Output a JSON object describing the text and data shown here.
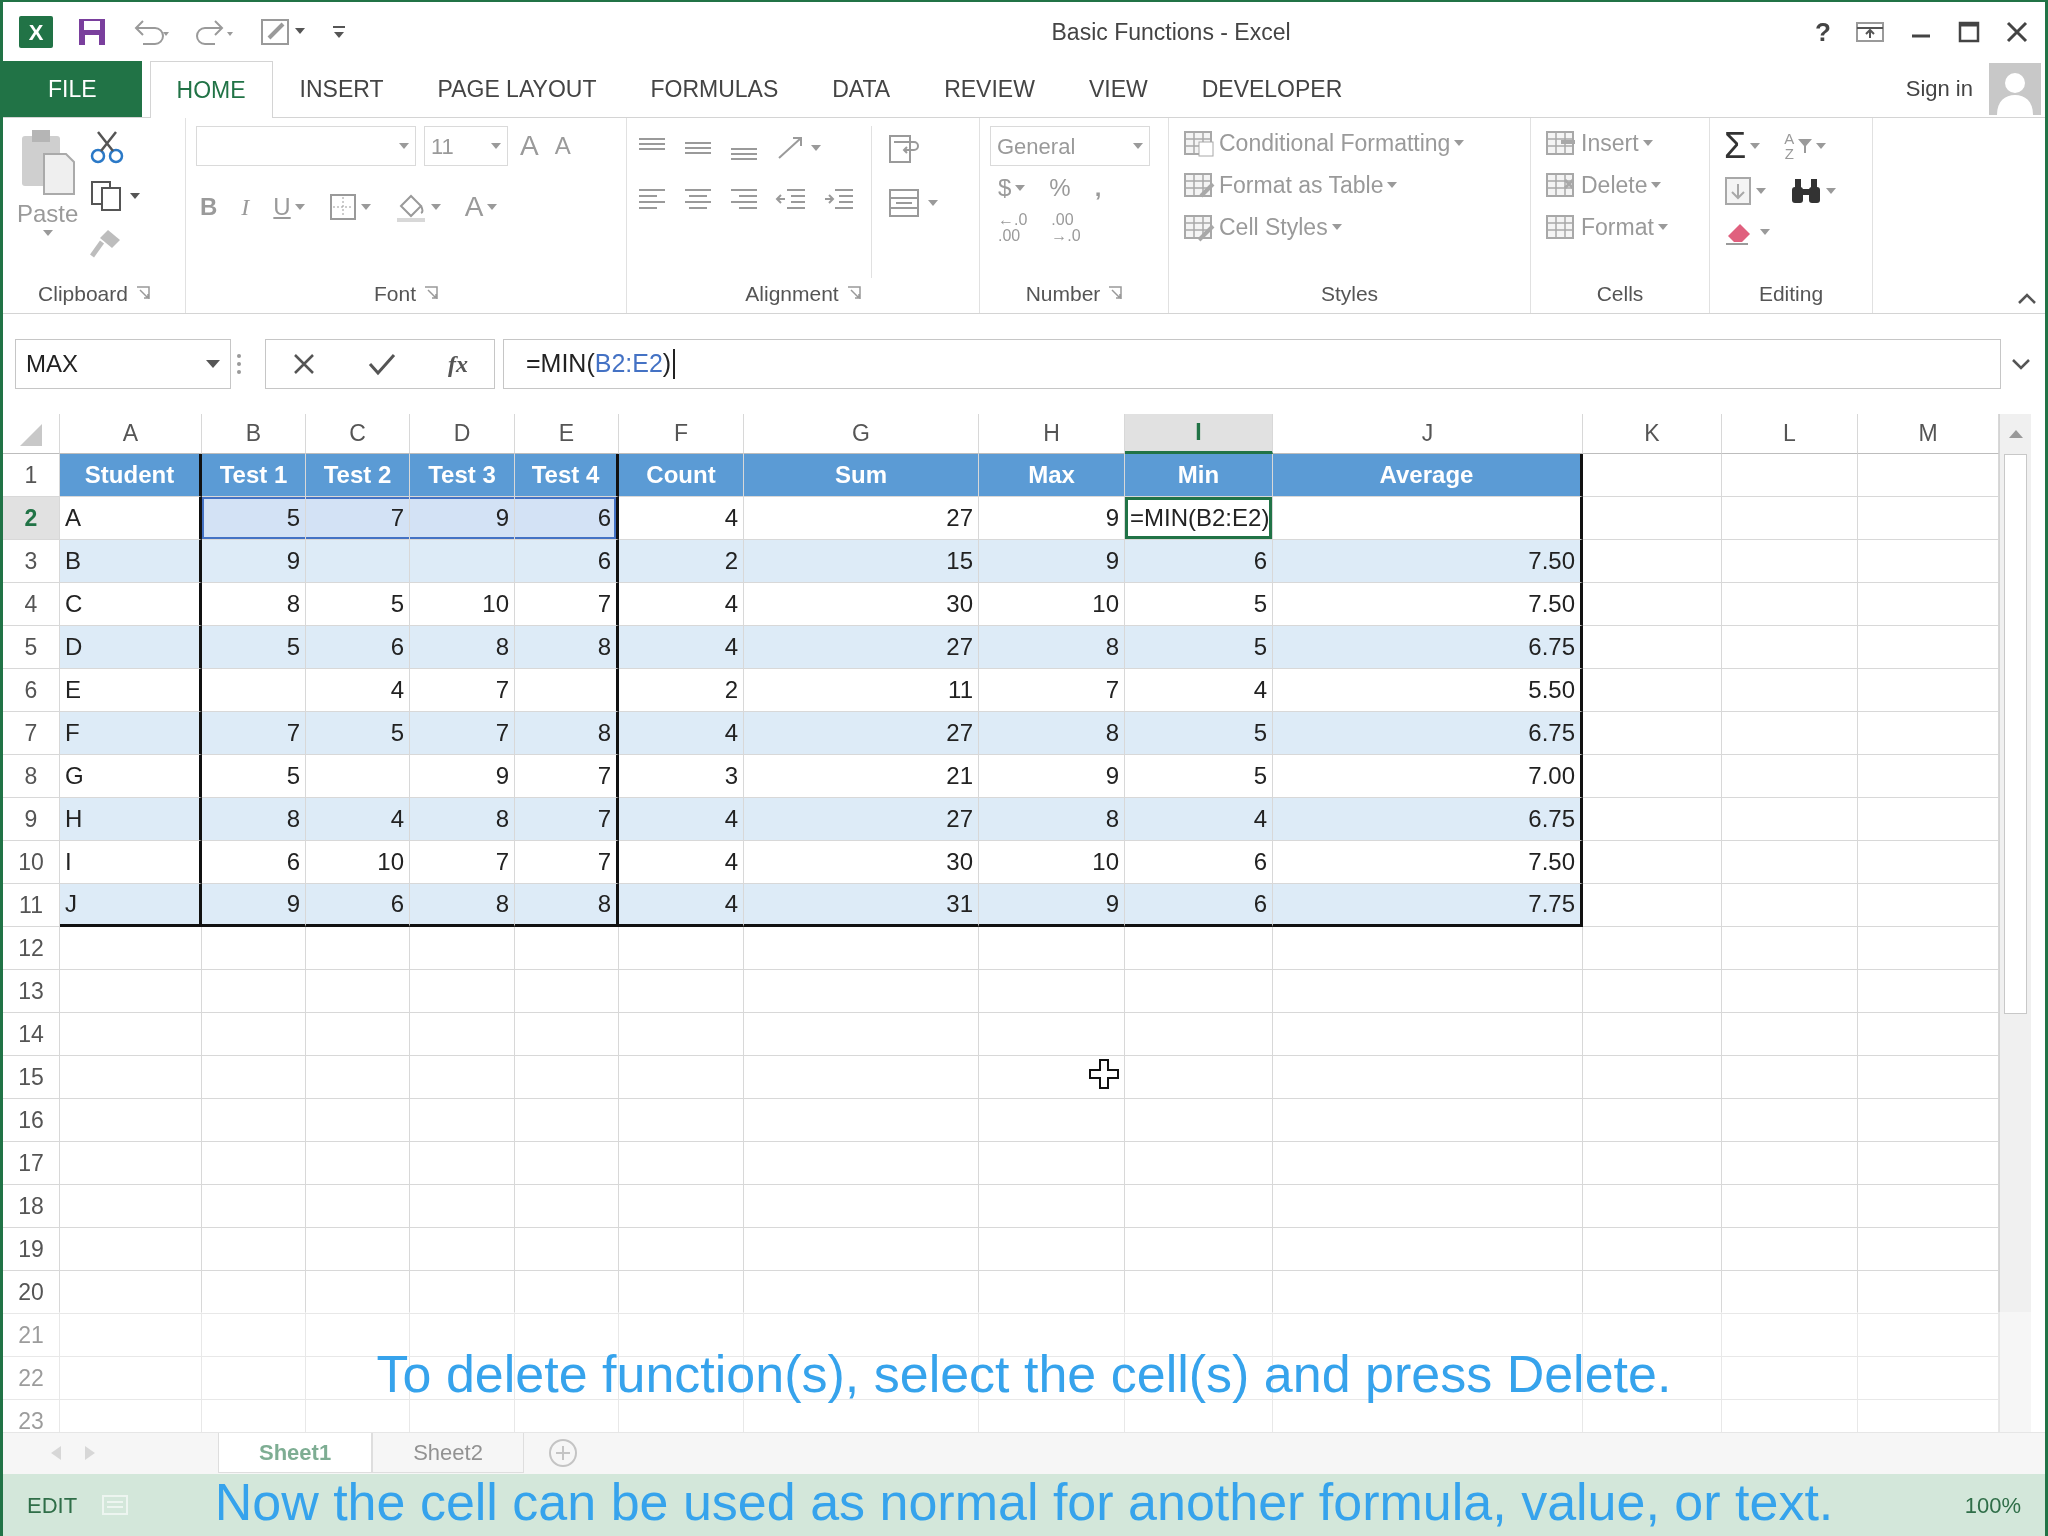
{
  "title_bar": {
    "logo": "X",
    "title": "Basic Functions - Excel",
    "help": "?"
  },
  "ribbon_tabs": [
    {
      "label": "FILE",
      "kind": "file",
      "selected": false
    },
    {
      "label": "HOME",
      "kind": "tab",
      "selected": true
    },
    {
      "label": "INSERT",
      "kind": "tab",
      "selected": false
    },
    {
      "label": "PAGE LAYOUT",
      "kind": "tab",
      "selected": false
    },
    {
      "label": "FORMULAS",
      "kind": "tab",
      "selected": false
    },
    {
      "label": "DATA",
      "kind": "tab",
      "selected": false
    },
    {
      "label": "REVIEW",
      "kind": "tab",
      "selected": false
    },
    {
      "label": "VIEW",
      "kind": "tab",
      "selected": false
    },
    {
      "label": "DEVELOPER",
      "kind": "tab",
      "selected": false
    }
  ],
  "account": {
    "label": "Sign in"
  },
  "ribbon": {
    "paste": "Paste",
    "font": {
      "font_size": "11",
      "grow": "A",
      "shrink": "A",
      "bold": "B",
      "italic": "I",
      "underline": "U",
      "font_color": "A"
    },
    "number": {
      "format": "General",
      "currency": "$",
      "percent": "%",
      "comma": ",",
      "increase_decimal": [
        "←.0",
        ".00"
      ],
      "decrease_decimal": [
        ".00",
        "→.0"
      ]
    },
    "styles": [
      "Conditional Formatting",
      "Format as Table",
      "Cell Styles"
    ],
    "cells": [
      "Insert",
      "Delete",
      "Format"
    ],
    "editing": {
      "autosum": "Σ",
      "sort": [
        "A",
        "Z"
      ]
    },
    "groups": [
      "Clipboard",
      "Font",
      "Alignment",
      "Number",
      "Styles",
      "Cells",
      "Editing"
    ]
  },
  "formula_bar": {
    "name_box": "MAX",
    "function_label": "fx",
    "formula": [
      {
        "text": "=MIN(",
        "kind": "plain"
      },
      {
        "text": "B2:E2",
        "kind": "reference"
      },
      {
        "text": ")",
        "kind": "plain"
      }
    ]
  },
  "sheet": {
    "columns": [
      {
        "label": "A",
        "selected": false,
        "referenced": false
      },
      {
        "label": "B",
        "selected": false,
        "referenced": true
      },
      {
        "label": "C",
        "selected": false,
        "referenced": true
      },
      {
        "label": "D",
        "selected": false,
        "referenced": true
      },
      {
        "label": "E",
        "selected": false,
        "referenced": true
      },
      {
        "label": "F",
        "selected": false,
        "referenced": false
      },
      {
        "label": "G",
        "selected": false,
        "referenced": false
      },
      {
        "label": "H",
        "selected": false,
        "referenced": false
      },
      {
        "label": "I",
        "selected": true,
        "referenced": false
      },
      {
        "label": "J",
        "selected": false,
        "referenced": false
      },
      {
        "label": "K",
        "selected": false,
        "referenced": false
      },
      {
        "label": "L",
        "selected": false,
        "referenced": false
      },
      {
        "label": "M",
        "selected": false,
        "referenced": false
      }
    ],
    "rows": [
      {
        "number": "1",
        "kind": "header",
        "selected": false,
        "referenced": false,
        "cells": [
          "Student",
          "Test 1",
          "Test 2",
          "Test 3",
          "Test 4",
          "Count",
          "Sum",
          "Max",
          "Min",
          "Average"
        ]
      },
      {
        "number": "2",
        "kind": "data",
        "selected": true,
        "referenced": true,
        "cells": [
          "A",
          "5",
          "7",
          "9",
          "6",
          "4",
          "27",
          "9",
          "=MIN(B2:E2)",
          null
        ]
      },
      {
        "number": "3",
        "kind": "data",
        "selected": false,
        "referenced": false,
        "cells": [
          "B",
          "9",
          null,
          null,
          "6",
          "2",
          "15",
          "9",
          "6",
          "7.50"
        ]
      },
      {
        "number": "4",
        "kind": "data",
        "selected": false,
        "referenced": false,
        "cells": [
          "C",
          "8",
          "5",
          "10",
          "7",
          "4",
          "30",
          "10",
          "5",
          "7.50"
        ]
      },
      {
        "number": "5",
        "kind": "data",
        "selected": false,
        "referenced": false,
        "cells": [
          "D",
          "5",
          "6",
          "8",
          "8",
          "4",
          "27",
          "8",
          "5",
          "6.75"
        ]
      },
      {
        "number": "6",
        "kind": "data",
        "selected": false,
        "referenced": false,
        "cells": [
          "E",
          null,
          "4",
          "7",
          null,
          "2",
          "11",
          "7",
          "4",
          "5.50"
        ]
      },
      {
        "number": "7",
        "kind": "data",
        "selected": false,
        "referenced": false,
        "cells": [
          "F",
          "7",
          "5",
          "7",
          "8",
          "4",
          "27",
          "8",
          "5",
          "6.75"
        ]
      },
      {
        "number": "8",
        "kind": "data",
        "selected": false,
        "referenced": false,
        "cells": [
          "G",
          "5",
          null,
          "9",
          "7",
          "3",
          "21",
          "9",
          "5",
          "7.00"
        ]
      },
      {
        "number": "9",
        "kind": "data",
        "selected": false,
        "referenced": false,
        "cells": [
          "H",
          "8",
          "4",
          "8",
          "7",
          "4",
          "27",
          "8",
          "4",
          "6.75"
        ]
      },
      {
        "number": "10",
        "kind": "data",
        "selected": false,
        "referenced": false,
        "cells": [
          "I",
          "6",
          "10",
          "7",
          "7",
          "4",
          "30",
          "10",
          "6",
          "7.50"
        ]
      },
      {
        "number": "11",
        "kind": "data",
        "selected": false,
        "referenced": false,
        "cells": [
          "J",
          "9",
          "6",
          "8",
          "8",
          "4",
          "31",
          "9",
          "6",
          "7.75"
        ]
      }
    ],
    "empty_rows": [
      "12",
      "13",
      "14",
      "15",
      "16",
      "17",
      "18",
      "19",
      "20",
      "21",
      "22",
      "23"
    ]
  },
  "sheet_tabs": [
    {
      "label": "Sheet1",
      "selected": true
    },
    {
      "label": "Sheet2",
      "selected": false
    }
  ],
  "status_bar": {
    "mode": "EDIT",
    "zoom": "100%"
  },
  "captions": [
    "To delete function(s), select the cell(s) and press Delete.",
    "Now the cell can be used as normal for another formula, value, or text."
  ]
}
